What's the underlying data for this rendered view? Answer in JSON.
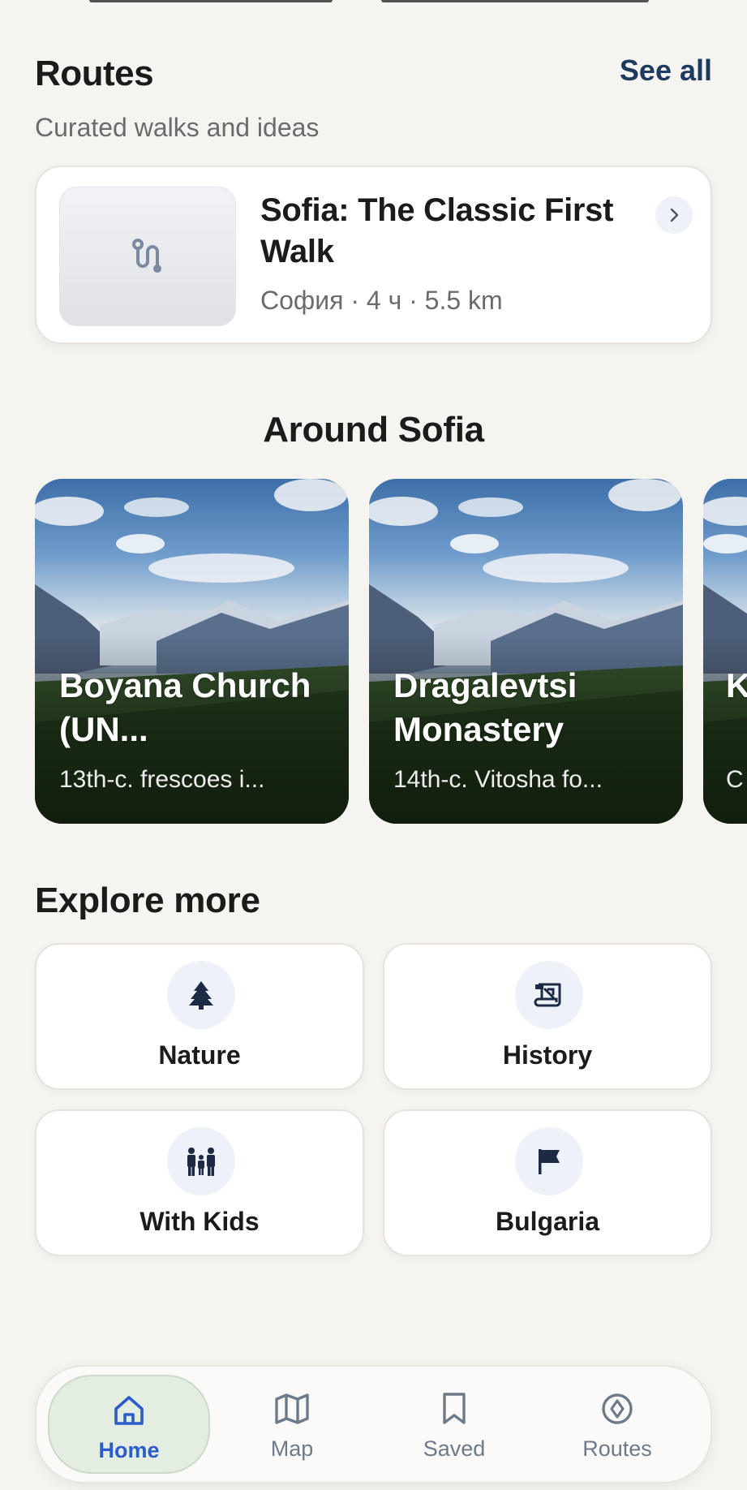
{
  "routes": {
    "title": "Routes",
    "see_all": "See all",
    "subtitle": "Curated walks and ideas",
    "card": {
      "title": "Sofia: The Classic First Walk",
      "meta": "София · 4 ч · 5.5 km"
    }
  },
  "around": {
    "title": "Around Sofia",
    "places": [
      {
        "name": "Boyana Church (UN...",
        "desc": "13th-c. frescoes i..."
      },
      {
        "name": "Dragalevtsi Monastery",
        "desc": "14th-c. Vitosha fo..."
      },
      {
        "name": "K v",
        "desc": "C"
      }
    ]
  },
  "explore": {
    "title": "Explore more",
    "tiles": [
      {
        "label": "Nature",
        "icon": "tree-icon"
      },
      {
        "label": "History",
        "icon": "history-scroll-icon"
      },
      {
        "label": "With Kids",
        "icon": "family-icon"
      },
      {
        "label": "Bulgaria",
        "icon": "flag-icon"
      }
    ]
  },
  "nav": {
    "items": [
      {
        "label": "Home",
        "icon": "home-icon",
        "active": true
      },
      {
        "label": "Map",
        "icon": "map-icon",
        "active": false
      },
      {
        "label": "Saved",
        "icon": "bookmark-icon",
        "active": false
      },
      {
        "label": "Routes",
        "icon": "compass-icon",
        "active": false
      }
    ]
  },
  "colors": {
    "background": "#f6f4f1",
    "accent": "#1e3a5f",
    "nav_active": "#2b5cc9",
    "nav_active_bg": "#e4ede2",
    "icon_bg": "#eef2f8"
  }
}
